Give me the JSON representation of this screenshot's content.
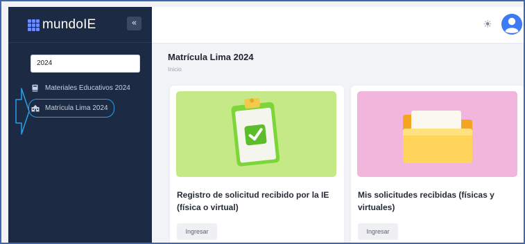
{
  "colors": {
    "sidebar_bg": "#1d2a44",
    "accent": "#3d7bf4",
    "highlight": "#2aa0e8",
    "card1_bg": "#c8ec8c",
    "card2_bg": "#f2b6dc"
  },
  "sidebar": {
    "logo_text": "mundoIE",
    "logo_icon": "grid-icon",
    "collapse_label": "«",
    "search_value": "2024",
    "items": [
      {
        "label": "Materiales Educativos 2024",
        "icon": "book-icon"
      },
      {
        "label": "Matrícula Lima 2024",
        "icon": "school-building-icon"
      }
    ]
  },
  "header": {
    "theme_icon": "sun-icon",
    "avatar_icon": "user-avatar-icon"
  },
  "main": {
    "title": "Matrícula Lima 2024",
    "breadcrumb": "Inicio",
    "cards": [
      {
        "title": "Registro de solicitud recibido por la IE (física o virtual)",
        "button": "Ingresar",
        "image": "clipboard-check-illustration"
      },
      {
        "title": "Mis solicitudes recibidas (físicas y virtuales)",
        "button": "Ingresar",
        "image": "folder-illustration"
      }
    ]
  }
}
